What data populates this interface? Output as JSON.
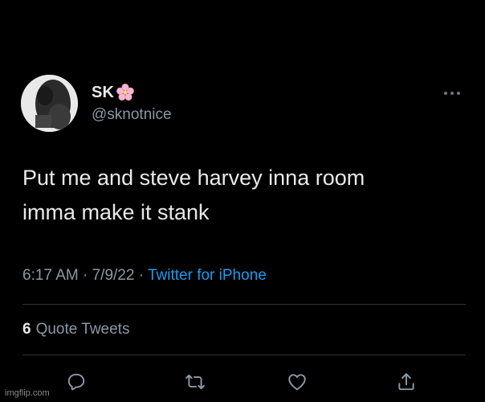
{
  "user": {
    "display_name": "SK",
    "handle": "@sknotnice",
    "name_emoji": "cherry-blossom-icon"
  },
  "tweet": {
    "lines": [
      "Put me and steve harvey inna room",
      "imma make it stank"
    ]
  },
  "meta": {
    "time": "6:17 AM",
    "separator": " · ",
    "date": "7/9/22",
    "source": "Twitter for iPhone"
  },
  "stats": {
    "quote_count": "6",
    "quote_label": "Quote Tweets"
  },
  "watermark": "imgflip.com",
  "colors": {
    "background": "#000000",
    "text": "#e7e9ea",
    "secondary": "#8b98a5",
    "link": "#1d9bf0",
    "divider": "#2f3336"
  }
}
